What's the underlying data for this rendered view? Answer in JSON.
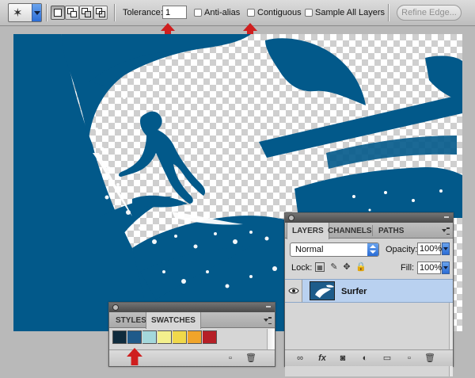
{
  "options_bar": {
    "tolerance_label": "Tolerance:",
    "tolerance_value": "1",
    "anti_alias_label": "Anti-alias",
    "contiguous_label": "Contiguous",
    "sample_all_layers_label": "Sample All Layers",
    "refine_edge_label": "Refine Edge..."
  },
  "swatches_panel": {
    "tabs": [
      "STYLES",
      "SWATCHES"
    ],
    "colors": [
      "#0f2b3d",
      "#1f5a8a",
      "#a4d8dc",
      "#f3f08d",
      "#f0d84a",
      "#f0a42a",
      "#b51f26"
    ]
  },
  "layers_panel": {
    "tabs": [
      "LAYERS",
      "CHANNELS",
      "PATHS"
    ],
    "blend_mode": "Normal",
    "opacity_label": "Opacity:",
    "opacity_value": "100%",
    "lock_label": "Lock:",
    "fill_label": "Fill:",
    "fill_value": "100%",
    "layer_name": "Surfer"
  },
  "colors": {
    "art_blue": "#02598a",
    "annotation_red": "#cf1f1f",
    "layer_selected": "#b9d1f0"
  }
}
